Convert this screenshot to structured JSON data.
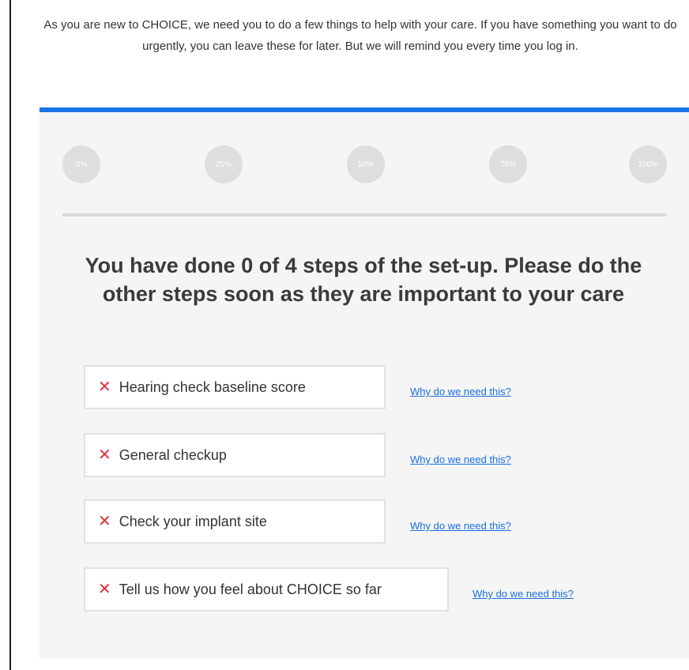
{
  "intro": {
    "text": "As you are new to CHOICE, we need you to do a few things to help with your care. If you have something you want to do urgently, you can leave these for later. But we will remind you every time you log in."
  },
  "progress": {
    "value_percent": 0,
    "milestones": [
      "0%",
      "25%",
      "50%",
      "75%",
      "100%"
    ]
  },
  "heading": "You have done 0 of 4 steps of the set-up. Please do the other steps soon as they are important to your care",
  "steps": [
    {
      "label": "Hearing check baseline score",
      "status_icon": "cross-icon",
      "link": "Why do we need this?"
    },
    {
      "label": "General checkup",
      "status_icon": "cross-icon",
      "link": "Why do we need this?"
    },
    {
      "label": "Check your implant site",
      "status_icon": "cross-icon",
      "link": "Why do we need this?"
    },
    {
      "label": "Tell us how you feel about CHOICE so far",
      "status_icon": "cross-icon",
      "link": "Why do we need this?"
    }
  ],
  "colors": {
    "accent": "#1a73e8",
    "incomplete": "#e0303a",
    "link": "#1a6fe0",
    "panel_bg": "#f5f5f5"
  }
}
